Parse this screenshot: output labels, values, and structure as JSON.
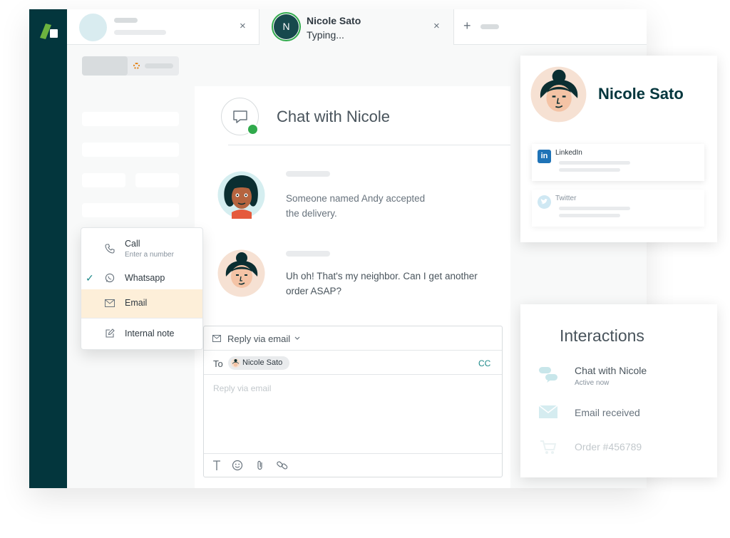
{
  "tabs": {
    "active_name": "Nicole Sato",
    "active_status": "Typing...",
    "active_avatar_initial": "N",
    "close_glyph": "×",
    "add_glyph": "+"
  },
  "conversation": {
    "title": "Chat with Nicole",
    "messages": [
      {
        "line1": "Someone named Andy accepted",
        "line2": "the delivery."
      },
      {
        "line1": "Uh oh! That's my neighbor. Can I get another",
        "line2": "order ASAP?"
      }
    ]
  },
  "channel_menu": {
    "items": [
      {
        "label": "Call",
        "sublabel": "Enter a number",
        "icon": "phone-icon"
      },
      {
        "label": "Whatsapp",
        "icon": "whatsapp-icon",
        "checked": true
      },
      {
        "label": "Email",
        "icon": "envelope-icon",
        "highlighted": true
      },
      {
        "label": "Internal note",
        "icon": "edit-note-icon"
      }
    ],
    "check_glyph": "✓"
  },
  "composer": {
    "mode_label": "Reply via email",
    "to_label": "To",
    "recipient": "Nicole Sato",
    "cc_label": "CC",
    "placeholder": "Reply via email",
    "toolbar_icons": [
      "text-format-icon",
      "emoji-icon",
      "attachment-icon",
      "link-icon"
    ]
  },
  "profile": {
    "name": "Nicole Sato",
    "social": [
      {
        "network": "LinkedIn",
        "icon_text": "in"
      },
      {
        "network": "Twitter"
      }
    ]
  },
  "interactions": {
    "title": "Interactions",
    "items": [
      {
        "label": "Chat with Nicole",
        "sublabel": "Active now"
      },
      {
        "label": "Email received"
      },
      {
        "label": "Order #456789"
      }
    ]
  },
  "colors": {
    "sidebar": "#03363d",
    "accent_green": "#30aa4c",
    "brand_green": "#1f7a3f",
    "highlight": "#fdefd9",
    "teal": "#1f73b7"
  }
}
